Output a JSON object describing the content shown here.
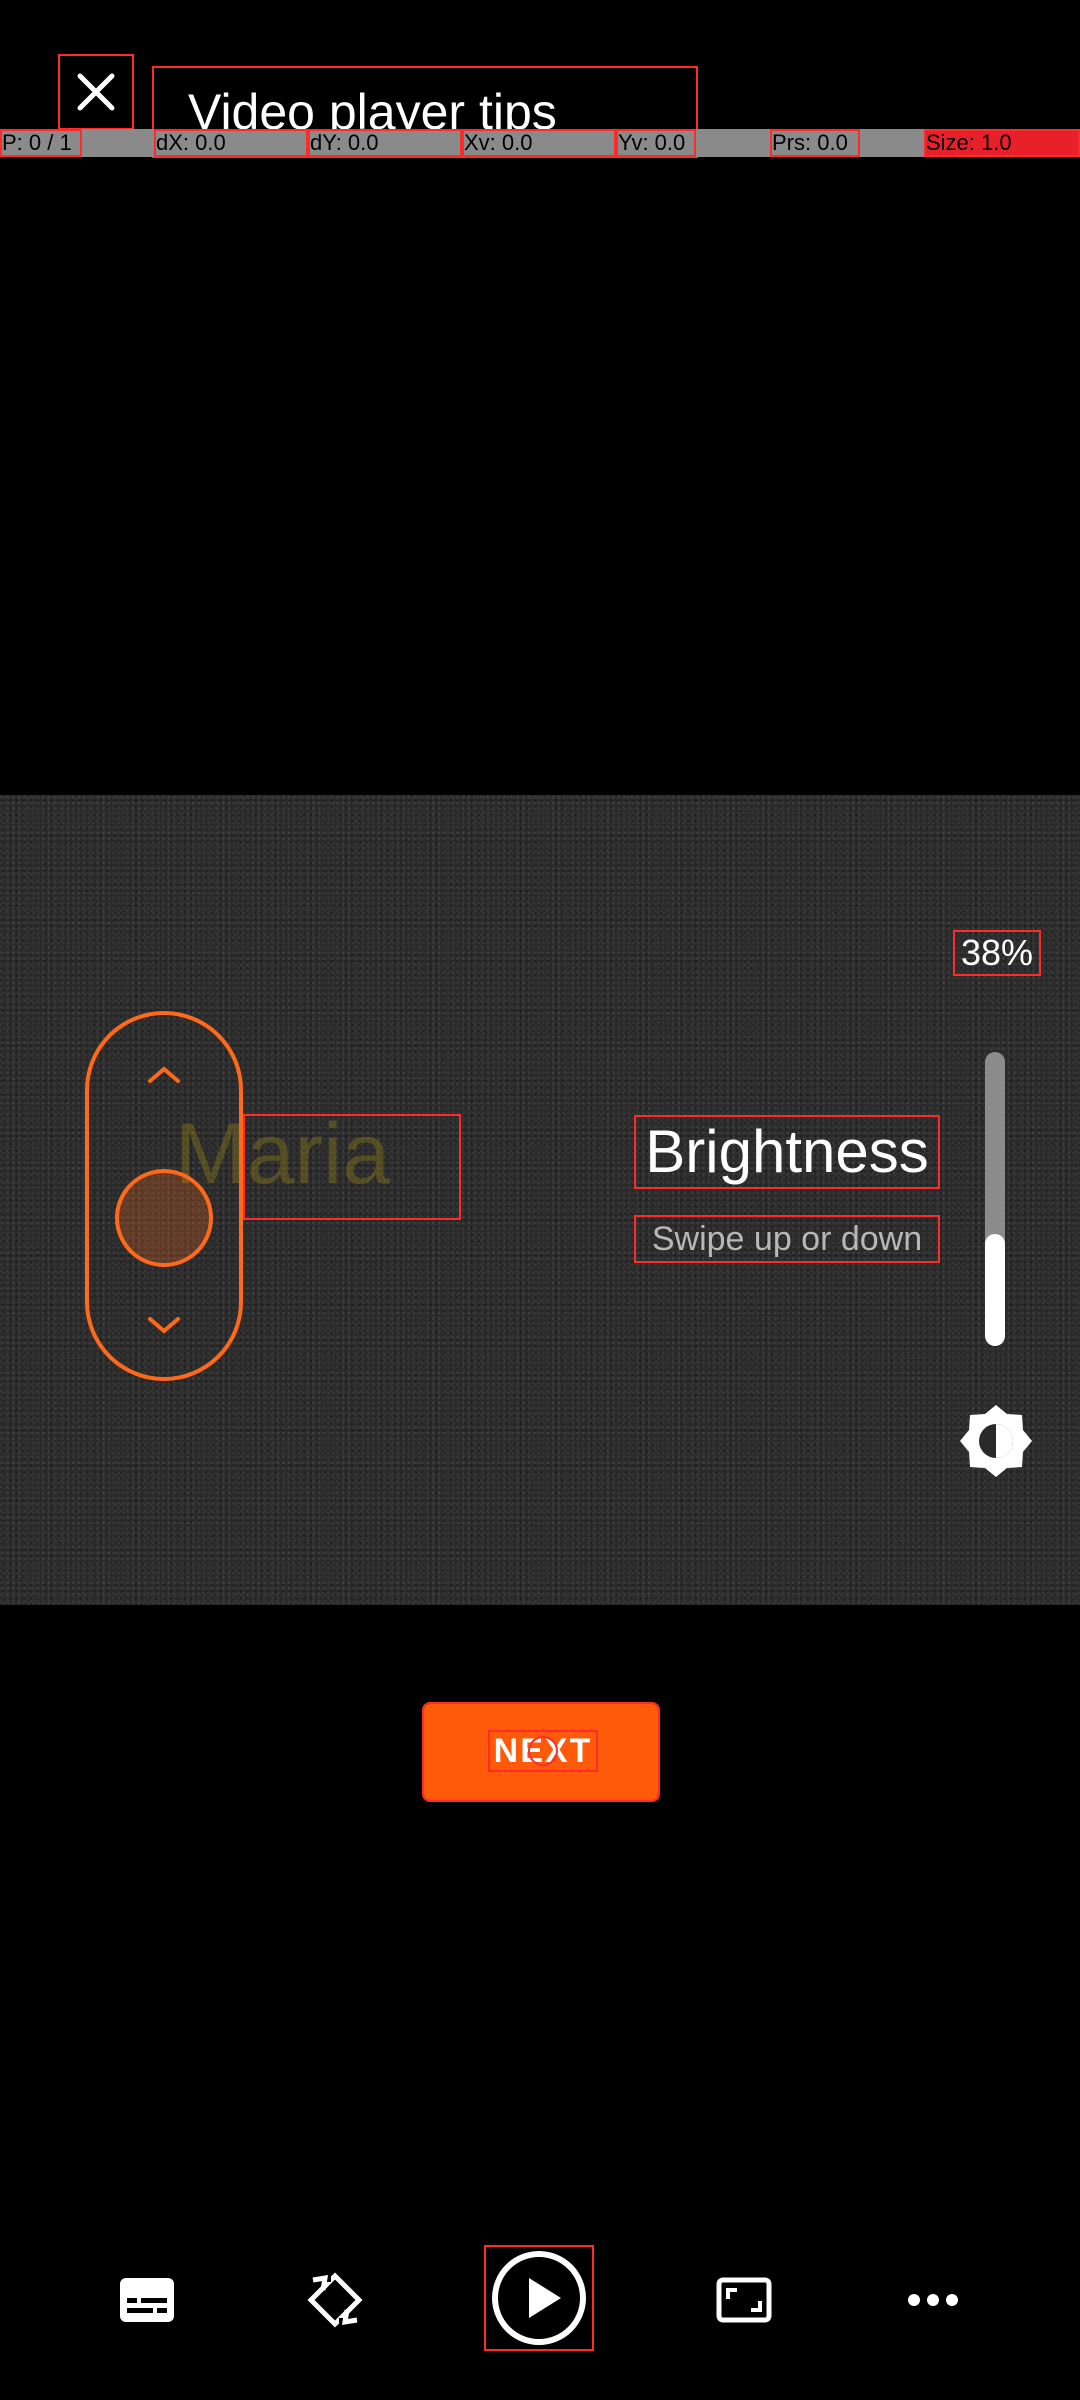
{
  "header": {
    "title": "Video player tips"
  },
  "debug": {
    "cells": [
      {
        "text": "P: 0 / 1"
      },
      {
        "text": "dX: 0.0"
      },
      {
        "text": "dY: 0.0"
      },
      {
        "text": "Xv: 0.0"
      },
      {
        "text": "Yv: 0.0"
      },
      {
        "text": "Prs: 0.0"
      },
      {
        "text": "Size: 1.0"
      }
    ]
  },
  "tip": {
    "title": "Brightness",
    "subtitle": "Swipe up or down",
    "percent": "38%",
    "level": 0.38,
    "watermark": "Maria"
  },
  "next_button": {
    "label": "NEXT"
  },
  "colors": {
    "accent": "#ff6a1a",
    "button": "#ff5a0a",
    "debug_highlight": "#ff2a2a"
  },
  "controls": [
    {
      "icon": "subtitles-icon"
    },
    {
      "icon": "rotate-icon"
    },
    {
      "icon": "play-icon"
    },
    {
      "icon": "aspect-ratio-icon"
    },
    {
      "icon": "more-icon"
    }
  ]
}
